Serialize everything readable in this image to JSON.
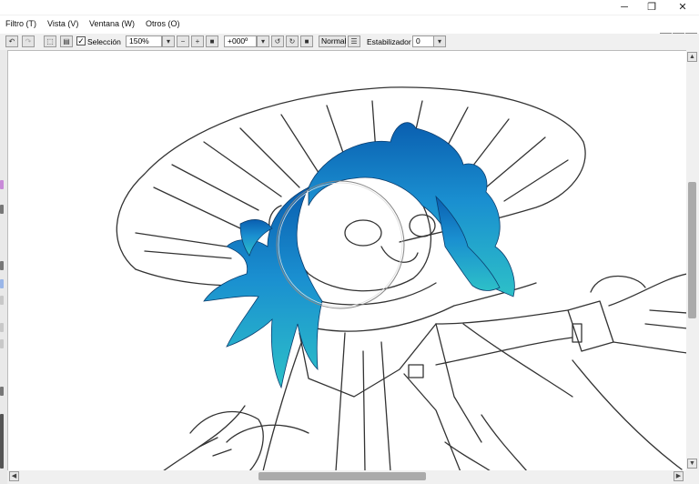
{
  "window": {
    "minimize_icon": "minimize-icon",
    "restore_icon": "restore-icon",
    "close_icon": "close-icon"
  },
  "menu": {
    "items": [
      {
        "label": "Filtro (T)"
      },
      {
        "label": "Vista (V)"
      },
      {
        "label": "Ventana (W)"
      },
      {
        "label": "Otros (O)"
      }
    ]
  },
  "toolbar": {
    "selection_label": "Selección",
    "selection_checked": true,
    "zoom_value": "150%",
    "rotation_value": "+000º",
    "blend_mode": "Normal",
    "stabilizer_label": "Estabilizador",
    "stabilizer_value": "0"
  },
  "colors": {
    "hair_dark": "#0a5fb0",
    "hair_mid": "#1a8fd0",
    "hair_light": "#2dc0c8",
    "line": "#333333"
  }
}
